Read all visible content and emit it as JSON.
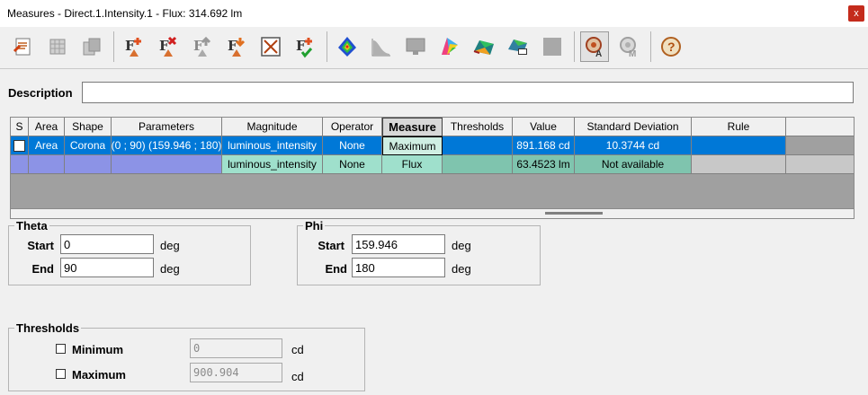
{
  "window": {
    "title": "Measures - Direct.1.Intensity.1 - Flux: 314.692 lm",
    "close_label": "x"
  },
  "toolbar": {
    "icons": [
      "edit-document-icon",
      "grid-icon",
      "copy-icon",
      "add-measure-icon",
      "delete-measure-icon",
      "move-up-icon",
      "move-down-icon",
      "fit-view-icon",
      "validate-measure-icon",
      "color-map-icon",
      "curve-icon",
      "monitor-icon",
      "spectrum-icon",
      "surface-icon",
      "display-3d-icon",
      "square-icon",
      "absolute-mode-icon",
      "relative-mode-icon",
      "help-icon"
    ]
  },
  "description": {
    "label": "Description",
    "value": ""
  },
  "grid": {
    "columns": [
      "S",
      "Area",
      "Shape",
      "Parameters",
      "Magnitude",
      "Operator",
      "Measure",
      "Thresholds",
      "Value",
      "Standard Deviation",
      "Rule",
      ""
    ],
    "rows": [
      {
        "area": "Area",
        "shape": "Corona",
        "parameters": "(0 ; 90) (159.946 ; 180)",
        "magnitude": "luminous_intensity",
        "operator": "None",
        "measure": "Maximum",
        "thresholds": "",
        "value": "891.168 cd",
        "std": "10.3744 cd",
        "rule": ""
      },
      {
        "area": "",
        "shape": "",
        "parameters": "",
        "magnitude": "luminous_intensity",
        "operator": "None",
        "measure": "Flux",
        "thresholds": "",
        "value": "63.4523 lm",
        "std": "Not available",
        "rule": ""
      }
    ]
  },
  "theta": {
    "legend": "Theta",
    "start_label": "Start",
    "start_value": "0",
    "end_label": "End",
    "end_value": "90",
    "unit": "deg"
  },
  "phi": {
    "legend": "Phi",
    "start_label": "Start",
    "start_value": "159.946",
    "end_label": "End",
    "end_value": "180",
    "unit": "deg"
  },
  "thresholds": {
    "legend": "Thresholds",
    "minimum_label": "Minimum",
    "minimum_value": "0",
    "maximum_label": "Maximum",
    "maximum_value": "900.904",
    "unit": "cd"
  },
  "colors": {
    "selection": "#0078d7",
    "close": "#c42b1c",
    "measure_cell": "#cfeee2",
    "row2_teal": "#9fe0cc",
    "row2_blue": "#8c93e6"
  }
}
